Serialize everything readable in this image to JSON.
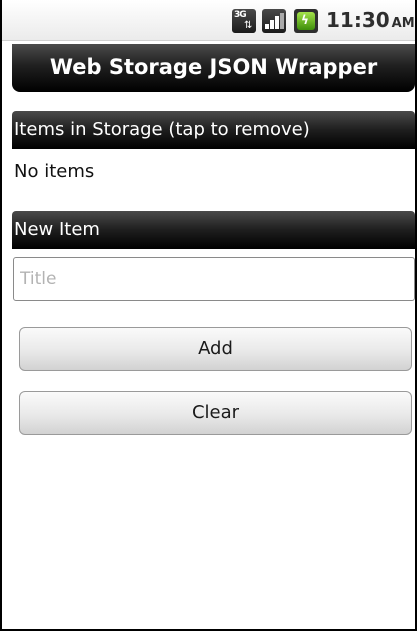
{
  "status_bar": {
    "network_icon": "3g-data-icon",
    "network_label": "3G",
    "signal_icon": "signal-strength-icon",
    "battery_icon": "battery-charging-icon",
    "time": "11:30",
    "ampm": "AM"
  },
  "app": {
    "title": "Web Storage JSON Wrapper"
  },
  "items_section": {
    "header": "Items in Storage (tap to remove)",
    "empty_text": "No items"
  },
  "new_item_section": {
    "header": "New Item",
    "title_input": {
      "placeholder": "Title",
      "value": ""
    }
  },
  "buttons": {
    "add_label": "Add",
    "clear_label": "Clear"
  },
  "colors": {
    "header_dark": "#000000",
    "header_light": "#4b4b4b",
    "battery_green": "#7cc229",
    "button_bg": "#e9e9e9"
  }
}
